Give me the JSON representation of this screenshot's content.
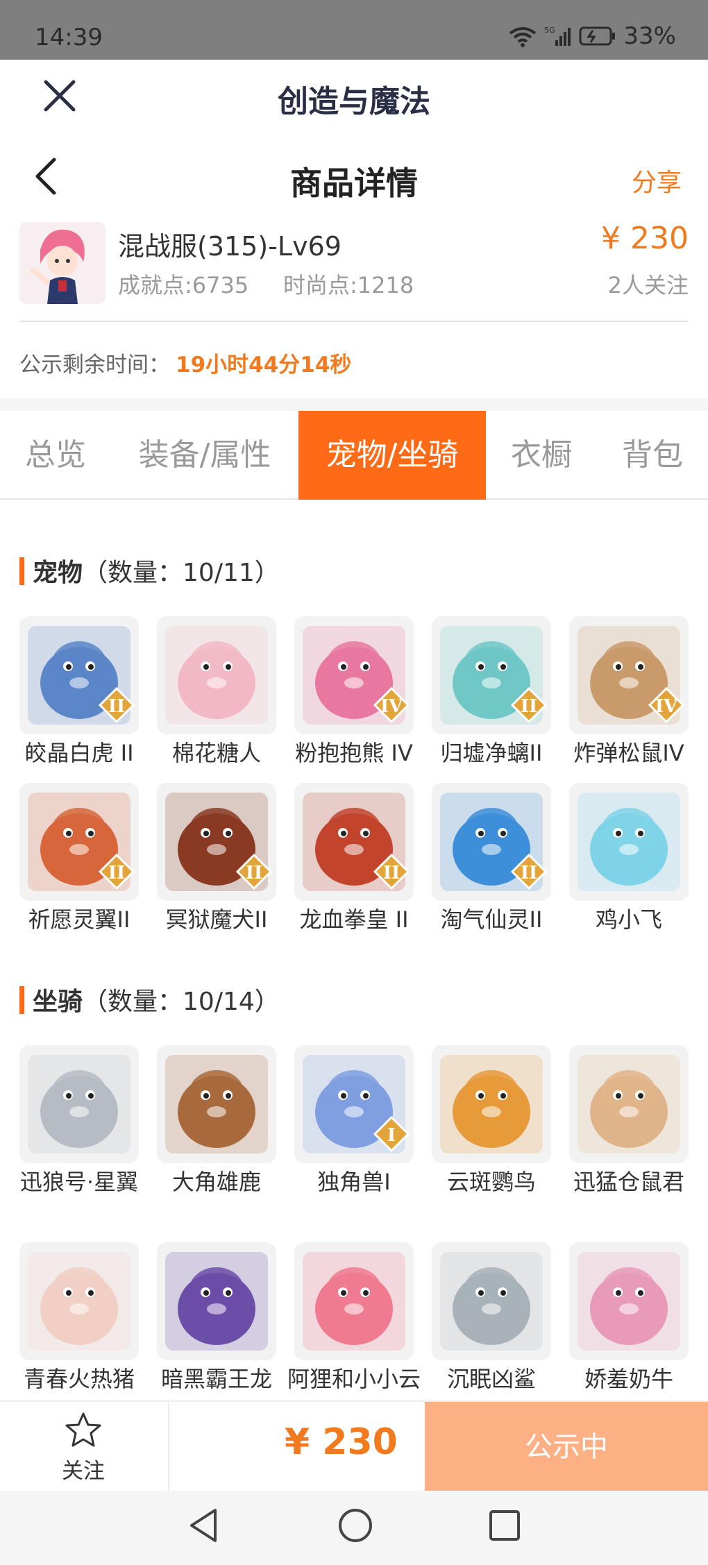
{
  "status_bar": {
    "time": "14:39",
    "battery": "33%"
  },
  "app_header": {
    "title": "创造与魔法"
  },
  "page_header": {
    "title": "商品详情",
    "share": "分享"
  },
  "product": {
    "name": "混战服(315)-Lv69",
    "achievement": "成就点:6735",
    "fashion": "时尚点:1218",
    "price": "¥ 230",
    "followers": "2人关注"
  },
  "notice": {
    "label": "公示剩余时间：",
    "time": "19小时44分14秒"
  },
  "tabs": [
    "总览",
    "装备/属性",
    "宠物/坐骑",
    "衣橱",
    "背包"
  ],
  "active_tab": 2,
  "pets": {
    "title": "宠物",
    "count": "（数量：10/11）",
    "items": [
      {
        "name": "皎晶白虎 II",
        "badge": "II",
        "color": "#5b86c8"
      },
      {
        "name": "棉花糖人",
        "badge": "",
        "color": "#f2b8c6"
      },
      {
        "name": "粉抱抱熊 IV",
        "badge": "IV",
        "color": "#e8789f"
      },
      {
        "name": "归墟净螭II",
        "badge": "II",
        "color": "#6fc7c6"
      },
      {
        "name": "炸弹松鼠IV",
        "badge": "IV",
        "color": "#c99b6a"
      },
      {
        "name": "祈愿灵翼II",
        "badge": "II",
        "color": "#d7673b"
      },
      {
        "name": "冥狱魔犬II",
        "badge": "II",
        "color": "#8a3a22"
      },
      {
        "name": "龙血拳皇 II",
        "badge": "II",
        "color": "#c2442d"
      },
      {
        "name": "淘气仙灵II",
        "badge": "II",
        "color": "#3e8fd9"
      },
      {
        "name": "鸡小飞",
        "badge": "",
        "color": "#7fd3e8"
      }
    ]
  },
  "mounts": {
    "title": "坐骑",
    "count": "（数量：10/14）",
    "items": [
      {
        "name": "迅狼号·星翼",
        "badge": "",
        "color": "#b7bcc4"
      },
      {
        "name": "大角雄鹿",
        "badge": "",
        "color": "#a86a3c"
      },
      {
        "name": "独角兽I",
        "badge": "I",
        "color": "#7f9fe0"
      },
      {
        "name": "云斑鹦鸟",
        "badge": "",
        "color": "#e69a3a"
      },
      {
        "name": "迅猛仓鼠君",
        "badge": "",
        "color": "#e0b48a"
      },
      {
        "name": "青春火热猪",
        "badge": "",
        "color": "#f1cfc4"
      },
      {
        "name": "暗黑霸王龙",
        "badge": "",
        "color": "#6b4ea8"
      },
      {
        "name": "阿狸和小小云·迅",
        "badge": "",
        "color": "#f07a8f"
      },
      {
        "name": "沉眠凶鲨",
        "badge": "",
        "color": "#a8b2b8"
      },
      {
        "name": "娇羞奶牛",
        "badge": "",
        "color": "#e89ab8"
      }
    ]
  },
  "bottom_bar": {
    "follow": "关注",
    "price": "¥ 230",
    "cta": "公示中"
  },
  "colors": {
    "accent": "#ff6a16",
    "price": "#f07a1d",
    "cta": "#fdb083"
  }
}
